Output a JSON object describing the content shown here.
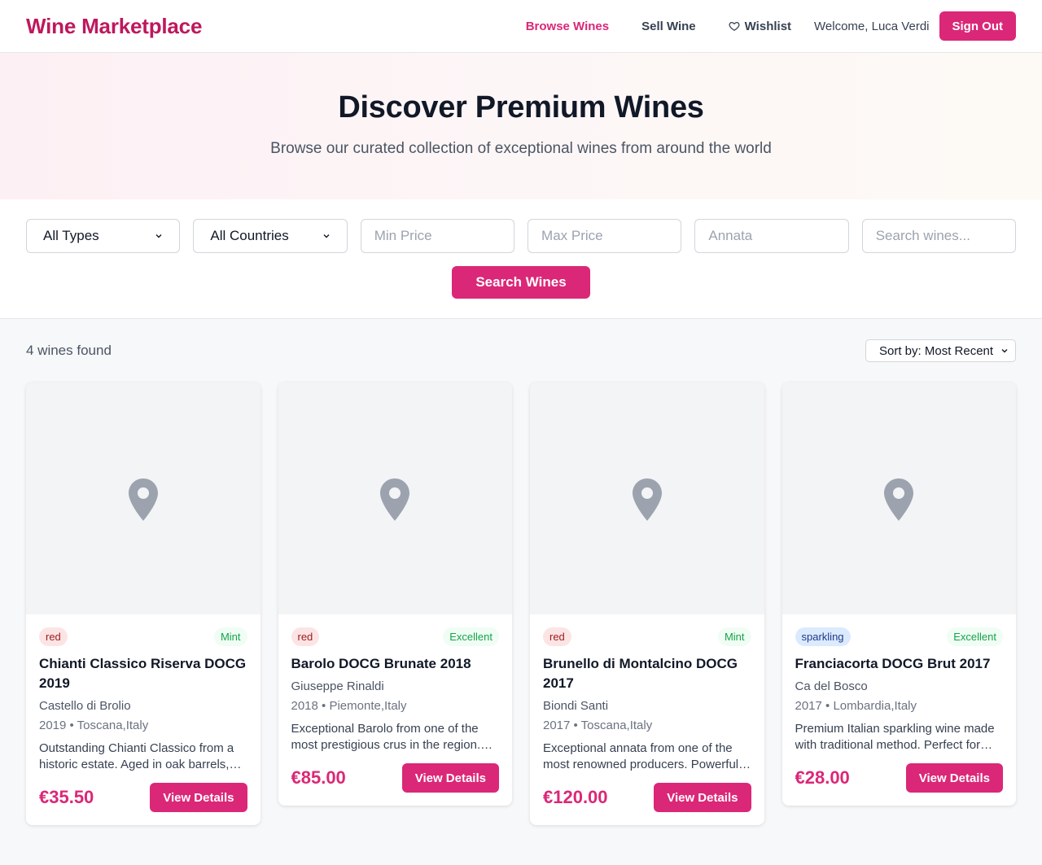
{
  "header": {
    "brand": "Wine Marketplace",
    "nav": {
      "browse": "Browse Wines",
      "sell": "Sell Wine",
      "wishlist": "Wishlist"
    },
    "welcome": "Welcome, Luca Verdi",
    "sign_out": "Sign Out"
  },
  "hero": {
    "title": "Discover Premium Wines",
    "subtitle": "Browse our curated collection of exceptional wines from around the world"
  },
  "filters": {
    "type_select": "All Types",
    "country_select": "All Countries",
    "min_price_placeholder": "Min Price",
    "max_price_placeholder": "Max Price",
    "annata_placeholder": "Annata",
    "search_placeholder": "Search wines...",
    "search_button": "Search Wines"
  },
  "results": {
    "count": "4 wines found",
    "sort": "Sort by: Most Recent"
  },
  "wines": [
    {
      "type": "red",
      "condition": "Mint",
      "title": "Chianti Classico Riserva DOCG 2019",
      "producer": "Castello di Brolio",
      "meta": "2019 • Toscana,Italy",
      "description": "Outstanding Chianti Classico from a historic estate. Aged in oak barrels, showing great complexity and elegance.",
      "price": "€35.50",
      "button": "View Details"
    },
    {
      "type": "red",
      "condition": "Excellent",
      "title": "Barolo DOCG Brunate 2018",
      "producer": "Giuseppe Rinaldi",
      "meta": "2018 • Piemonte,Italy",
      "description": "Exceptional Barolo from one of the most prestigious crus in the region. Great aging potential.",
      "price": "€85.00",
      "button": "View Details"
    },
    {
      "type": "red",
      "condition": "Mint",
      "title": "Brunello di Montalcino DOCG 2017",
      "producer": "Biondi Santi",
      "meta": "2017 • Toscana,Italy",
      "description": "Exceptional annata from one of the most renowned producers. Powerful and structured.",
      "price": "€120.00",
      "button": "View Details"
    },
    {
      "type": "sparkling",
      "condition": "Excellent",
      "title": "Franciacorta DOCG Brut 2017",
      "producer": "Ca del Bosco",
      "meta": "2017 • Lombardia,Italy",
      "description": "Premium Italian sparkling wine made with traditional method. Perfect for celebrations.",
      "price": "€28.00",
      "button": "View Details"
    }
  ],
  "colors": {
    "accent": "#db2777",
    "brand": "#be185d",
    "condition_text": "#16a34a"
  },
  "icons": {
    "wishlist": "heart-icon",
    "image_placeholder": "map-pin-icon",
    "dropdown": "chevron-down-icon"
  }
}
